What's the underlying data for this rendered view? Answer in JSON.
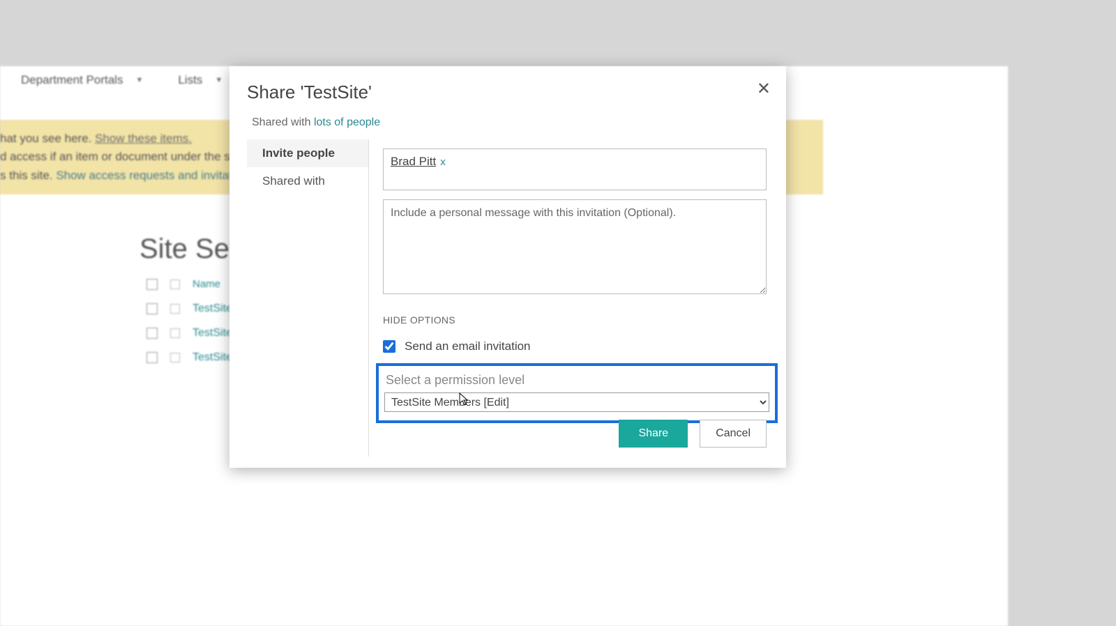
{
  "nav": {
    "items": [
      "Department Portals",
      "Lists"
    ]
  },
  "banner": {
    "line1a": "hat you see here.  ",
    "line1b": "Show these items.",
    "line2": "d access if an item or document under the site",
    "line3a": "s this site. ",
    "line3b": "Show access requests and invitation"
  },
  "page": {
    "heading": "Site Sett",
    "col_name": "Name",
    "rows": [
      "TestSite",
      "TestSite",
      "TestSite"
    ]
  },
  "modal": {
    "title": "Share 'TestSite'",
    "close": "✕",
    "shared_prefix": "Shared with ",
    "shared_link": "lots of people",
    "nav": {
      "invite": "Invite people",
      "shared_with": "Shared with"
    },
    "person": {
      "name": "Brad Pitt",
      "remove": "x"
    },
    "message_placeholder": "Include a personal message with this invitation (Optional).",
    "hide_options": "HIDE OPTIONS",
    "email_label": "Send an email invitation",
    "perm_label": "Select a permission level",
    "perm_value": "TestSite Members [Edit]",
    "share_btn": "Share",
    "cancel_btn": "Cancel"
  }
}
